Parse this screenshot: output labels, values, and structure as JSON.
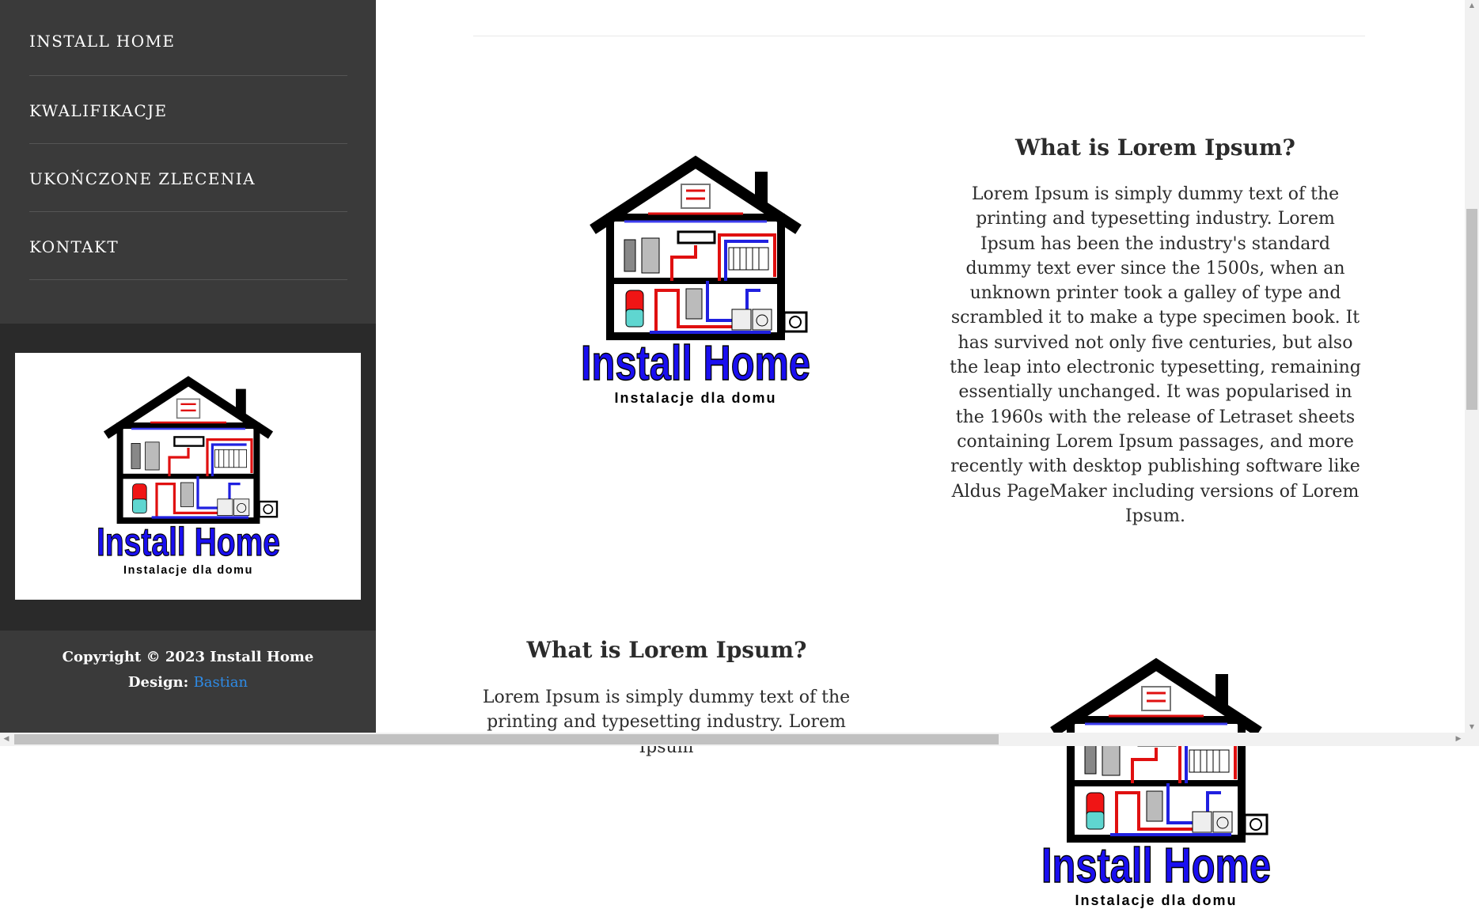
{
  "nav": {
    "items": [
      {
        "label": "INSTALL HOME"
      },
      {
        "label": "KWALIFIKACJE"
      },
      {
        "label": "UKOŃCZONE ZLECENIA"
      },
      {
        "label": "KONTAKT"
      }
    ]
  },
  "logo": {
    "brand": "Install Home",
    "tagline": "Instalacje dla domu"
  },
  "footer": {
    "copyright": "Copyright © 2023 Install Home",
    "design_label": "Design:",
    "designer_link": "Bastian"
  },
  "sections": [
    {
      "title": "What is Lorem Ipsum?",
      "text": "Lorem Ipsum is simply dummy text of the printing and typesetting industry. Lorem Ipsum has been the industry's standard dummy text ever since the 1500s, when an unknown printer took a galley of type and scrambled it to make a type specimen book. It has survived not only five centuries, but also the leap into electronic typesetting, remaining essentially unchanged. It was popularised in the 1960s with the release of Letraset sheets containing Lorem Ipsum passages, and more recently with desktop publishing software like Aldus PageMaker including versions of Lorem Ipsum."
    },
    {
      "title": "What is Lorem Ipsum?",
      "text": "Lorem Ipsum is simply dummy text of the printing and typesetting industry. Lorem Ipsum"
    }
  ],
  "colors": {
    "sidebar_bg": "#3a3a3a",
    "logo_band_bg": "#2a2a2a",
    "link": "#2e8be6",
    "brand_blue": "#1a0ff0"
  }
}
